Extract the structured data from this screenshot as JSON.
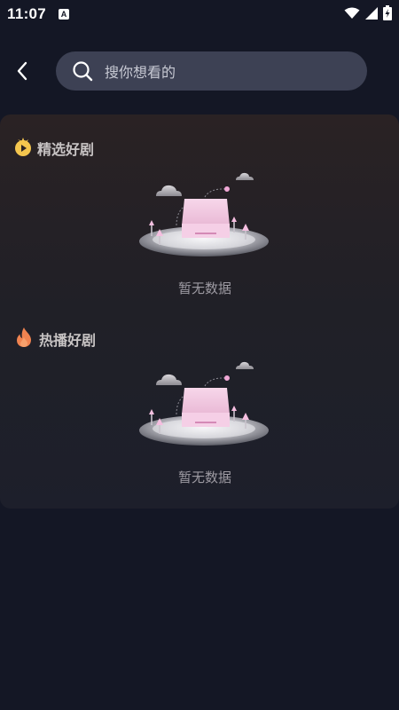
{
  "status_bar": {
    "time": "11:07",
    "notification_badge": "A",
    "icons": [
      "wifi-icon",
      "signal-icon",
      "battery-charging-icon"
    ]
  },
  "header": {
    "back_icon": "chevron-left-icon",
    "search": {
      "icon": "search-icon",
      "placeholder": "搜你想看的"
    }
  },
  "sections": [
    {
      "icon": "film-reel-icon",
      "title": "精选好剧",
      "empty_text": "暂无数据"
    },
    {
      "icon": "flame-icon",
      "title": "热播好剧",
      "empty_text": "暂无数据"
    }
  ],
  "colors": {
    "background": "#141725",
    "search_bar": "#3d4154",
    "reel_icon": "#f4c64e",
    "flame_icon": "#f08350",
    "illustration_pink": "#f3cbe6"
  }
}
